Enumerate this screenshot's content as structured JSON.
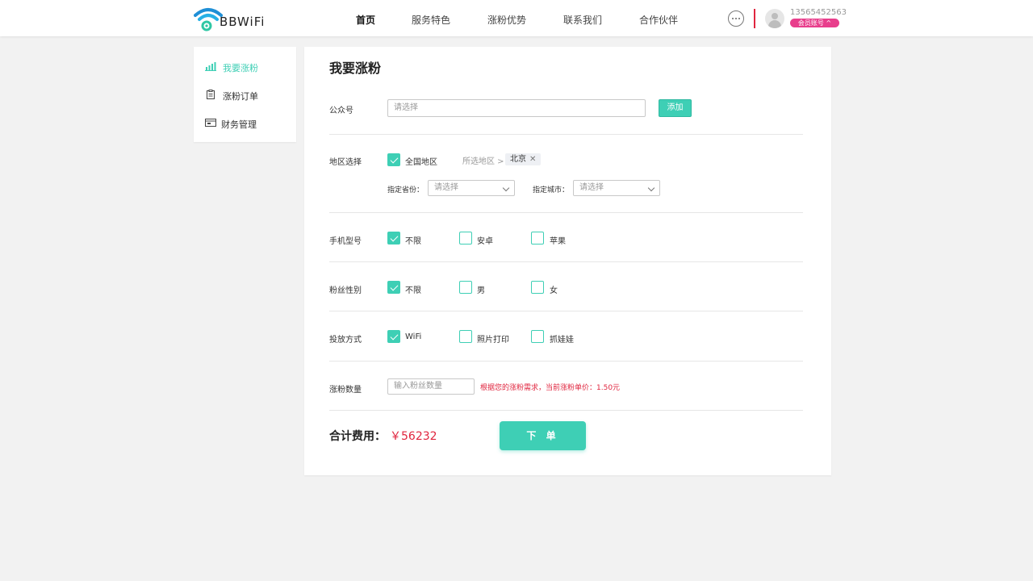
{
  "brand": {
    "logo_text": "BBWiFi"
  },
  "nav": [
    {
      "label": "首页",
      "active": true
    },
    {
      "label": "服务特色"
    },
    {
      "label": "涨粉优势"
    },
    {
      "label": "联系我们"
    },
    {
      "label": "合作伙伴"
    }
  ],
  "user": {
    "phone": "13565452563",
    "badge": "会员账号 ^"
  },
  "sidebar": [
    {
      "label": "我要涨粉",
      "icon": "bar-chart-icon",
      "active": true
    },
    {
      "label": "涨粉订单",
      "icon": "clipboard-icon"
    },
    {
      "label": "财务管理",
      "icon": "wallet-icon"
    }
  ],
  "form": {
    "title": "我要涨粉",
    "account": {
      "label": "公众号",
      "placeholder": "请选择",
      "add_label": "添加"
    },
    "region": {
      "label": "地区选择",
      "all_label": "全国地区",
      "all_checked": true,
      "selected_prefix": "所选地区 >",
      "selected_tag": "北京",
      "province_label": "指定省份：",
      "province_placeholder": "请选择",
      "city_label": "指定城市：",
      "city_placeholder": "请选择"
    },
    "phone_model": {
      "label": "手机型号",
      "options": [
        {
          "label": "不限",
          "checked": true
        },
        {
          "label": "安卓",
          "checked": false
        },
        {
          "label": "苹果",
          "checked": false
        }
      ]
    },
    "gender": {
      "label": "粉丝性别",
      "options": [
        {
          "label": "不限",
          "checked": true
        },
        {
          "label": "男",
          "checked": false
        },
        {
          "label": "女",
          "checked": false
        }
      ]
    },
    "delivery": {
      "label": "投放方式",
      "options": [
        {
          "label": "WiFi",
          "checked": true
        },
        {
          "label": "照片打印",
          "checked": false
        },
        {
          "label": "抓娃娃",
          "checked": false
        }
      ]
    },
    "quantity": {
      "label": "涨粉数量",
      "placeholder": "输入粉丝数量",
      "hint": "根据您的涨粉需求，当前涨粉单价：1.50元"
    },
    "total_label": "合计费用：",
    "total_value": "￥56232",
    "submit_label": "下 单"
  },
  "colors": {
    "accent": "#3ecfb5",
    "danger": "#e0263f",
    "badge": "#e83e8c"
  }
}
